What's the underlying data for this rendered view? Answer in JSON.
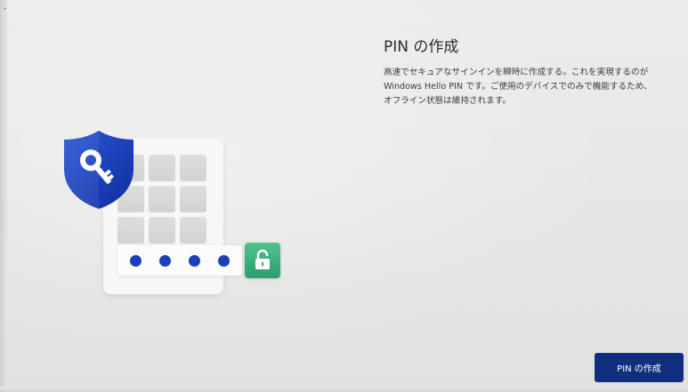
{
  "screen": {
    "title": "PIN の作成",
    "description_lines": [
      "高速でセキュアなサインインを瞬時に作成する。これを実現するのが",
      "Windows Hello PIN です。ご使用のデバイスでのみで機能するため、",
      "オフライン状態は維持されます。"
    ],
    "corner_mark": "-"
  },
  "actions": {
    "create_pin_label": "PIN の作成"
  },
  "illustration": {
    "shield_icon": "key-shield-icon",
    "lock_icon": "unlock-icon",
    "pin_dots_count": 4,
    "colors": {
      "shield": "#1a3fbf",
      "pin_dot": "#1d3fb8",
      "unlock_badge": "#38a878",
      "button": "#10307f"
    }
  }
}
